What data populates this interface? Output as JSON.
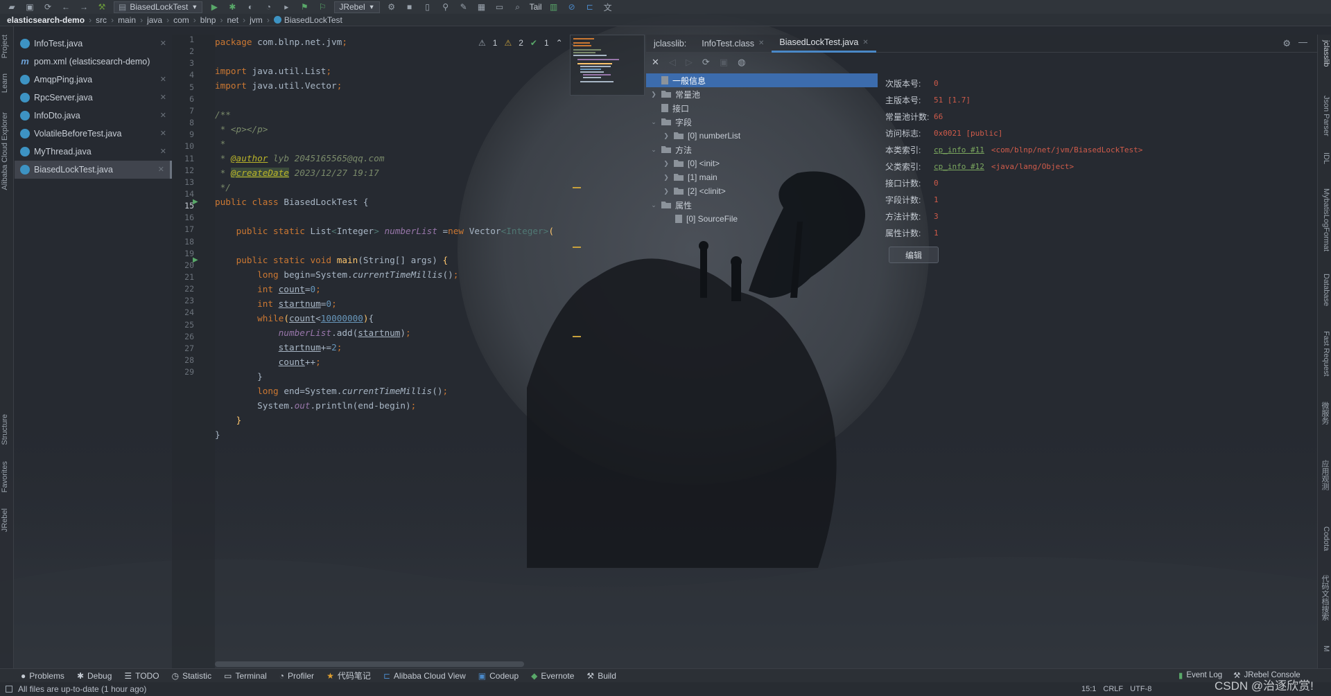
{
  "toolbar": {
    "run_config": "BiasedLockTest",
    "jrebel": "JRebel",
    "tail": "Tail"
  },
  "breadcrumb": [
    "elasticsearch-demo",
    "src",
    "main",
    "java",
    "com",
    "blnp",
    "net",
    "jvm",
    "BiasedLockTest"
  ],
  "left_stripe": [
    "Project",
    "Learn",
    "Alibaba Cloud Explorer",
    "Structure",
    "Favorites",
    "JRebel"
  ],
  "files": [
    {
      "name": "InfoTest.java",
      "icon": "java-class-icon"
    },
    {
      "name": "pom.xml (elasticsearch-demo)",
      "icon": "maven-icon"
    },
    {
      "name": "AmqpPing.java",
      "icon": "java-class-icon"
    },
    {
      "name": "RpcServer.java",
      "icon": "java-class-icon"
    },
    {
      "name": "InfoDto.java",
      "icon": "java-class-icon"
    },
    {
      "name": "VolatileBeforeTest.java",
      "icon": "java-class-icon"
    },
    {
      "name": "MyThread.java",
      "icon": "java-class-icon"
    },
    {
      "name": "BiasedLockTest.java",
      "icon": "java-class-icon",
      "active": true
    }
  ],
  "editor": {
    "line_numbers": [
      "1",
      "2",
      "3",
      "4",
      "5",
      "6",
      "7",
      "8",
      "9",
      "10",
      "11",
      "12",
      "13",
      "14",
      "15",
      "16",
      "17",
      "18",
      "19",
      "20",
      "21",
      "22",
      "23",
      "24",
      "25",
      "26",
      "27",
      "28",
      "29"
    ],
    "current_line": "15",
    "inspections": {
      "warn1": "1",
      "warn2": "2",
      "ok": "1"
    },
    "comment": {
      "p": " * <p></p>",
      "star": " *",
      "author_tag": "@author",
      "author_val": " lyb 2045165565@qq.com",
      "date_tag": "@createDate",
      "date_val": " 2023/12/27 19:17"
    }
  },
  "right_panel": {
    "tabs": [
      "jclasslib:",
      "InfoTest.class",
      "BiasedLockTest.java"
    ],
    "tree": [
      {
        "label": "一般信息",
        "depth": 0,
        "kind": "file",
        "selected": true
      },
      {
        "label": "常量池",
        "depth": 0,
        "kind": "folder",
        "chev": "collapsed"
      },
      {
        "label": "接口",
        "depth": 0,
        "kind": "file"
      },
      {
        "label": "字段",
        "depth": 0,
        "kind": "folder",
        "chev": "expanded"
      },
      {
        "label": "[0] numberList",
        "depth": 1,
        "kind": "folder",
        "chev": "collapsed"
      },
      {
        "label": "方法",
        "depth": 0,
        "kind": "folder",
        "chev": "expanded"
      },
      {
        "label": "[0] <init>",
        "depth": 1,
        "kind": "folder",
        "chev": "collapsed"
      },
      {
        "label": "[1] main",
        "depth": 1,
        "kind": "folder",
        "chev": "collapsed"
      },
      {
        "label": "[2] <clinit>",
        "depth": 1,
        "kind": "folder",
        "chev": "collapsed"
      },
      {
        "label": "属性",
        "depth": 0,
        "kind": "folder",
        "chev": "expanded"
      },
      {
        "label": "[0] SourceFile",
        "depth": 1,
        "kind": "file"
      }
    ],
    "general_info": [
      {
        "label": "次版本号:",
        "value": "0"
      },
      {
        "label": "主版本号:",
        "value": "51 [1.7]"
      },
      {
        "label": "常量池计数:",
        "value": "66"
      },
      {
        "label": "访问标志:",
        "value": "0x0021 [public]"
      },
      {
        "label": "本类索引:",
        "link": "cp_info #11",
        "value": "<com/blnp/net/jvm/BiasedLockTest>"
      },
      {
        "label": "父类索引:",
        "link": "cp_info #12",
        "value": "<java/lang/Object>"
      },
      {
        "label": "接口计数:",
        "value": "0"
      },
      {
        "label": "字段计数:",
        "value": "1"
      },
      {
        "label": "方法计数:",
        "value": "3"
      },
      {
        "label": "属性计数:",
        "value": "1"
      }
    ],
    "edit_button": "编辑"
  },
  "right_stripe": [
    "jclasslib",
    "Json Parser",
    "IDL",
    "MybatisLogFormat",
    "Database",
    "Fast Request",
    "微服务",
    "应用观测",
    "Codota",
    "代码文档搜索",
    "M"
  ],
  "bottom_tools": [
    "Problems",
    "Debug",
    "TODO",
    "Statistic",
    "Terminal",
    "Profiler",
    "代码笔记",
    "Alibaba Cloud View",
    "Codeup",
    "Evernote",
    "Build"
  ],
  "bottom_right": [
    "Event Log",
    "JRebel Console"
  ],
  "status": {
    "message": "All files are up-to-date (1 hour ago)",
    "position": "15:1",
    "line_sep": "CRLF",
    "encoding": "UTF-8"
  },
  "watermark": "CSDN @治逐欣赏!",
  "colors": {
    "accent": "#4a88c7",
    "selection": "#3c6cad",
    "info_value": "#d05b4a",
    "info_link": "#7ca95f"
  }
}
